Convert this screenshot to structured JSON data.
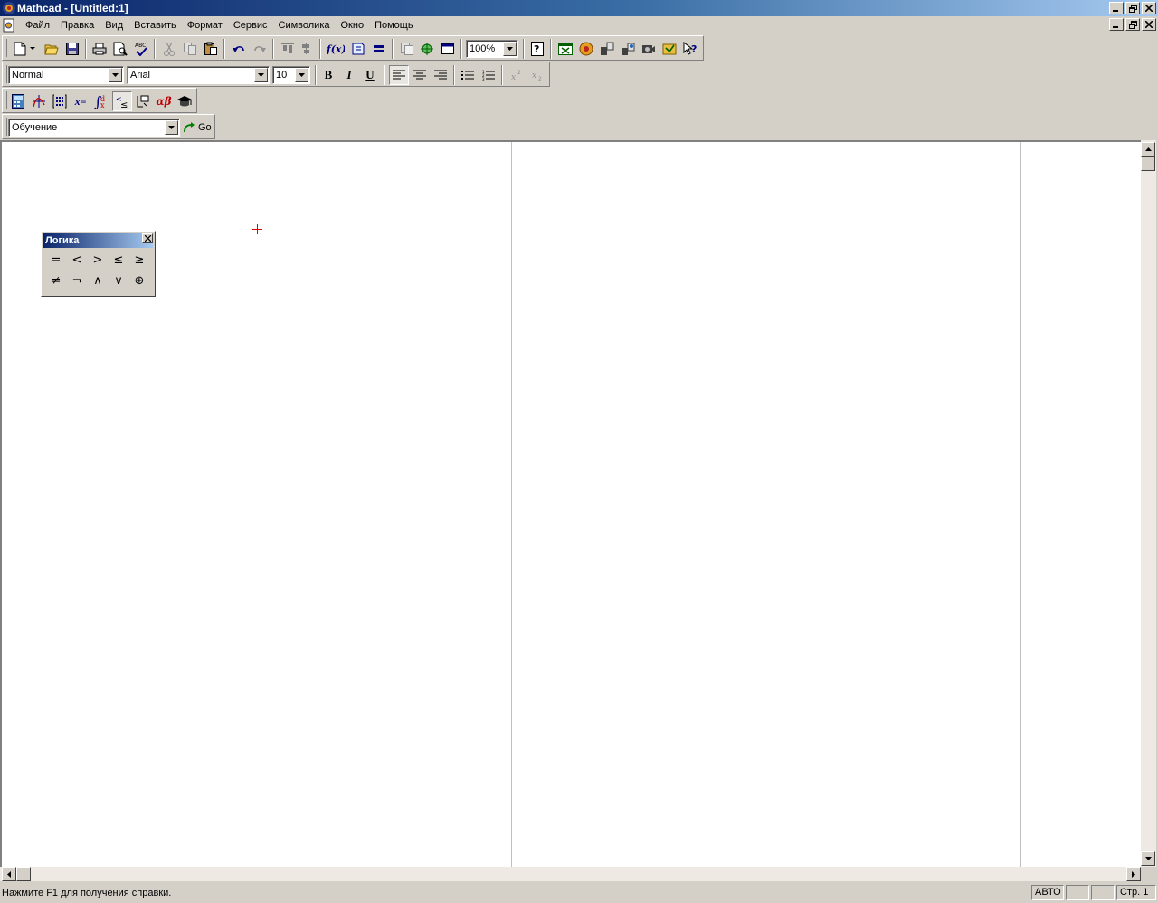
{
  "window": {
    "title": "Mathcad - [Untitled:1]"
  },
  "menu": [
    "Файл",
    "Правка",
    "Вид",
    "Вставить",
    "Формат",
    "Сервис",
    "Символика",
    "Окно",
    "Помощь"
  ],
  "formatting": {
    "style": "Normal",
    "font": "Arial",
    "size": "10",
    "bold": "B",
    "italic": "I",
    "underline": "U"
  },
  "standard": {
    "zoom": "100%",
    "function_label": "f(x)"
  },
  "resources": {
    "selected": "Обучение",
    "go_label": "Go"
  },
  "palette": {
    "title": "Логика",
    "row1": [
      "=",
      "<",
      ">",
      "≤",
      "≥"
    ],
    "row2": [
      "≠",
      "¬",
      "∧",
      "∨",
      "⊕"
    ]
  },
  "math_toolbar": {
    "evaluate_label": "x=",
    "greek_label": "αβ"
  },
  "status": {
    "message": "Нажмите F1 для получения справки.",
    "mode": "АВТО",
    "page": "Стр. 1"
  },
  "colors": {
    "title_start": "#0a246a",
    "title_end": "#a6caf0",
    "chrome": "#d4d0c8",
    "cursor": "#e00000"
  }
}
